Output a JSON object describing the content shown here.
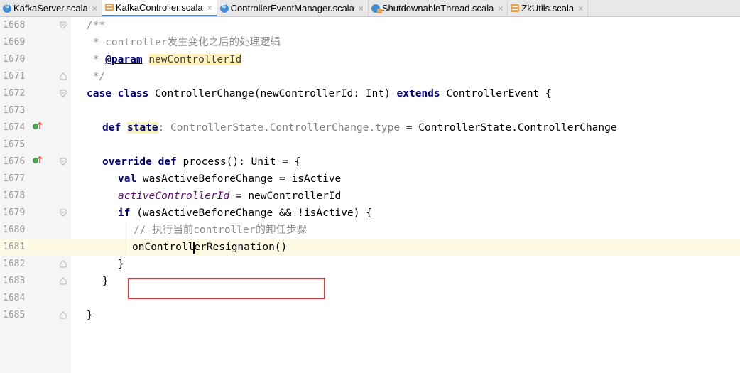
{
  "tabs": [
    {
      "label": "KafkaServer.scala",
      "icon": "scala-class-icon",
      "active": false
    },
    {
      "label": "KafkaController.scala",
      "icon": "scala-object-icon",
      "active": true
    },
    {
      "label": "ControllerEventManager.scala",
      "icon": "scala-class-icon",
      "active": false
    },
    {
      "label": "ShutdownableThread.scala",
      "icon": "scala-class-object-icon",
      "active": false
    },
    {
      "label": "ZkUtils.scala",
      "icon": "scala-object-icon",
      "active": false
    }
  ],
  "close_glyph": "×",
  "lines": {
    "l1668": {
      "num": "1668",
      "text": "/**"
    },
    "l1669": {
      "num": "1669",
      "text": " * controller发生变化之后的处理逻辑"
    },
    "l1670": {
      "num": "1670",
      "star": " * ",
      "tag": "@param",
      "val": "newControllerId"
    },
    "l1671": {
      "num": "1671",
      "text": " */"
    },
    "l1672": {
      "num": "1672",
      "kw1": "case class",
      "rest1": " ControllerChange(newControllerId: Int) ",
      "kw2": "extends",
      "rest2": " ControllerEvent {"
    },
    "l1673": {
      "num": "1673"
    },
    "l1674": {
      "num": "1674",
      "kw": "def",
      "name": "state",
      "type": ": ControllerState.ControllerChange.type",
      "rest": " = ControllerState.ControllerChange"
    },
    "l1675": {
      "num": "1675"
    },
    "l1676": {
      "num": "1676",
      "kw": "override def",
      "rest": " process(): Unit = {"
    },
    "l1677": {
      "num": "1677",
      "kw": "val",
      "rest": " wasActiveBeforeChange = isActive"
    },
    "l1678": {
      "num": "1678",
      "field": "activeControllerId",
      "rest": " = newControllerId"
    },
    "l1679": {
      "num": "1679",
      "kw": "if",
      "rest": " (wasActiveBeforeChange && !isActive) {"
    },
    "l1680": {
      "num": "1680",
      "text": "// 执行当前controller的卸任步骤"
    },
    "l1681": {
      "num": "1681",
      "pre": "onControll",
      "post": "erResignation()"
    },
    "l1682": {
      "num": "1682",
      "text": "}"
    },
    "l1683": {
      "num": "1683",
      "text": "}"
    },
    "l1684": {
      "num": "1684"
    },
    "l1685": {
      "num": "1685",
      "text": "}"
    }
  },
  "colors": {
    "keyword": "#000080",
    "comment": "#8c8c8c",
    "field": "#660e7a",
    "current_line": "#fffae3",
    "highlight_box": "#d63a3a"
  }
}
